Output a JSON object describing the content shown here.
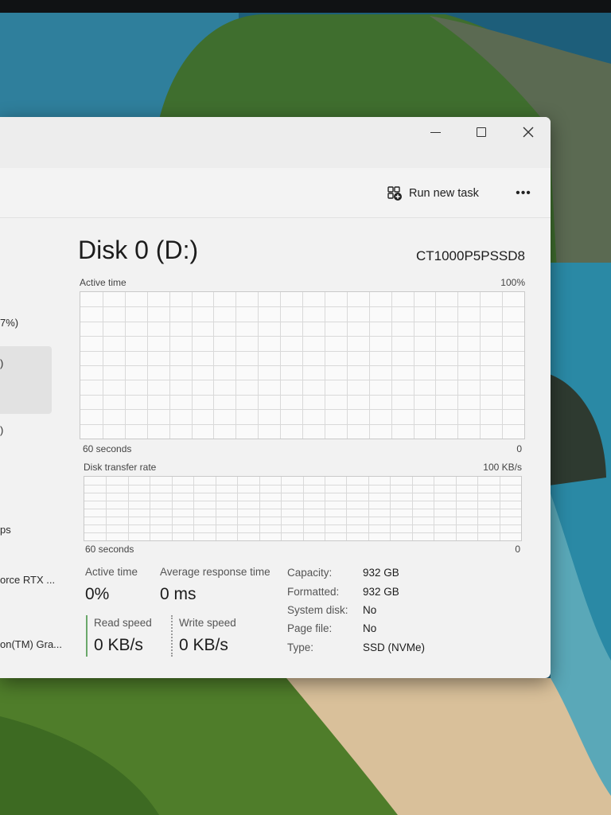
{
  "toolbar": {
    "run_new_task": "Run new task",
    "more": "•••"
  },
  "sidebar": {
    "fragments": [
      "7%)",
      ")",
      ")",
      "ps",
      "orce RTX ...",
      "on(TM) Gra..."
    ]
  },
  "disk": {
    "title": "Disk 0 (D:)",
    "model": "CT1000P5PSSD8"
  },
  "active_time_graph": {
    "label": "Active time",
    "max": "100%",
    "time_span": "60 seconds",
    "min": "0"
  },
  "transfer_rate_graph": {
    "label": "Disk transfer rate",
    "max": "100 KB/s",
    "time_span": "60 seconds",
    "min": "0"
  },
  "stats": {
    "active_time_label": "Active time",
    "active_time_value": "0%",
    "avg_response_label": "Average response time",
    "avg_response_value": "0 ms",
    "read_speed_label": "Read speed",
    "read_speed_value": "0 KB/s",
    "write_speed_label": "Write speed",
    "write_speed_value": "0 KB/s"
  },
  "properties": [
    {
      "key": "Capacity:",
      "value": "932 GB"
    },
    {
      "key": "Formatted:",
      "value": "932 GB"
    },
    {
      "key": "System disk:",
      "value": "No"
    },
    {
      "key": "Page file:",
      "value": "No"
    },
    {
      "key": "Type:",
      "value": "SSD (NVMe)"
    }
  ],
  "colors": {
    "read_accent": "#6aa86a",
    "grid": "#d9d9d9"
  }
}
